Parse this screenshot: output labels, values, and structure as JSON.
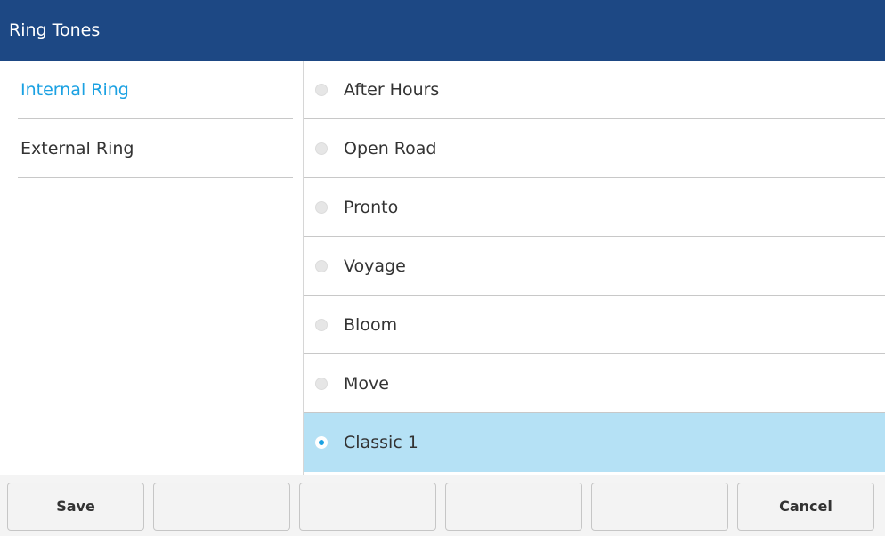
{
  "colors": {
    "header_bg": "#1d4884",
    "accent": "#1ba1e2",
    "selected_row_bg": "#b5e1f5"
  },
  "header": {
    "title": "Ring Tones"
  },
  "categories": [
    {
      "label": "Internal Ring",
      "selected": true
    },
    {
      "label": "External Ring",
      "selected": false
    }
  ],
  "ring_tones": [
    {
      "label": "After Hours",
      "selected": false
    },
    {
      "label": "Open Road",
      "selected": false
    },
    {
      "label": "Pronto",
      "selected": false
    },
    {
      "label": "Voyage",
      "selected": false
    },
    {
      "label": "Bloom",
      "selected": false
    },
    {
      "label": "Move",
      "selected": false
    },
    {
      "label": "Classic 1",
      "selected": true
    }
  ],
  "softkeys": [
    {
      "label": "Save"
    },
    {
      "label": ""
    },
    {
      "label": ""
    },
    {
      "label": ""
    },
    {
      "label": ""
    },
    {
      "label": "Cancel"
    }
  ]
}
